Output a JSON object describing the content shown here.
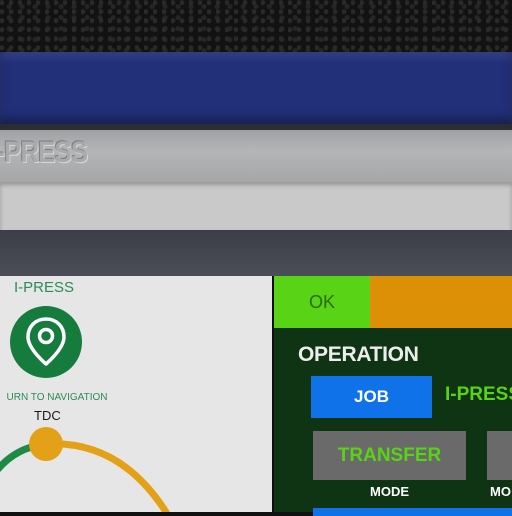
{
  "housing": {
    "embossed_brand": "I-PRESS"
  },
  "left_panel": {
    "title": "I-PRESS",
    "nav_button_icon": "map-pin-icon",
    "nav_label": "URN TO NAVIGATION",
    "tdc_label": "TDC"
  },
  "status": {
    "ok_label": "OK",
    "colors": {
      "ok": "#58d315",
      "amber": "#db9006"
    }
  },
  "operation": {
    "title": "OPERATION",
    "job_button": "JOB",
    "job_value": "I-PRESS",
    "transfer_button": "TRANSFER",
    "mode_label": "MODE",
    "mode_label_2": "MO"
  },
  "colors": {
    "accent_blue": "#0f72e8",
    "panel_green": "#0f3413",
    "brand_green": "#167c3d",
    "gauge_orange": "#e3a117",
    "gauge_green": "#1e8a45"
  }
}
